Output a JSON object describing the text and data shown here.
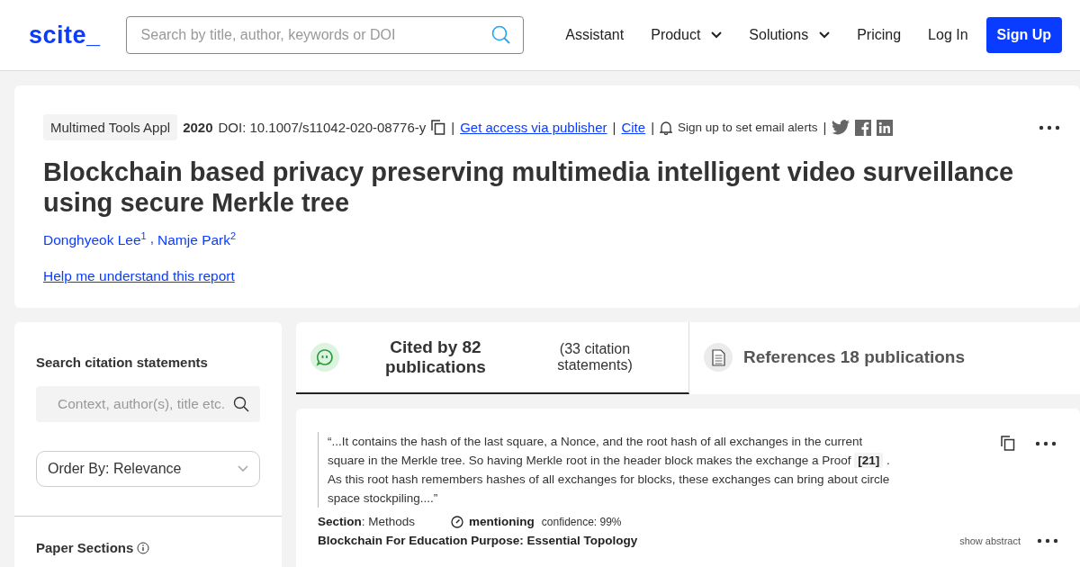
{
  "header": {
    "logo": "scite_",
    "search": {
      "placeholder": "Search by title, author, keywords or DOI"
    },
    "nav": [
      {
        "label": "Assistant",
        "kind": "link"
      },
      {
        "label": "Product",
        "kind": "dropdown"
      },
      {
        "label": "Solutions",
        "kind": "dropdown"
      },
      {
        "label": "Pricing",
        "kind": "link"
      },
      {
        "label": "Log In",
        "kind": "link"
      }
    ],
    "signup": "Sign Up"
  },
  "paper": {
    "journal": "Multimed Tools Appl",
    "year": "2020",
    "doi": "DOI: 10.1007/s11042-020-08776-y",
    "access_link": "Get access via publisher",
    "cite_link": "Cite",
    "alerts": "Sign up to set email alerts",
    "separator": "|",
    "title": "Blockchain based privacy preserving multimedia intelligent video surveillance using secure Merkle tree",
    "authors": [
      {
        "name": "Donghyeok Lee",
        "affiliation": "1"
      },
      {
        "name": "Namje Park",
        "affiliation": "2"
      }
    ],
    "author_separator": ",",
    "help_link": "Help me understand this report"
  },
  "sidebar": {
    "search_label": "Search citation statements",
    "search": {
      "placeholder": "Context, author(s), title etc."
    },
    "order_by": "Order By: Relevance",
    "sections_heading": "Paper Sections"
  },
  "tabs": [
    {
      "kind": "cited",
      "title": "Cited by 82 publications",
      "subtitle": "(33 citation statements)",
      "selected": true
    },
    {
      "kind": "references",
      "title": "References 18 publications",
      "selected": false
    }
  ],
  "citations": [
    {
      "quote": "“...It contains the hash of the last square, a Nonce, and the root hash of all exchanges in the current square in the Merkle tree. So having Merkle root in the header block makes the exchange a Proof **[21]** . As this root hash remembers hashes of all exchanges for blocks, these exchanges can bring about circle space stockpiling....”",
      "section": "**Section**: Methods",
      "type": "mentioning",
      "confidence": "confidence: 99%"
    }
  ],
  "next_result": {
    "title": "Blockchain For Education Purpose: Essential Topology",
    "show_abstract": "show abstract"
  }
}
